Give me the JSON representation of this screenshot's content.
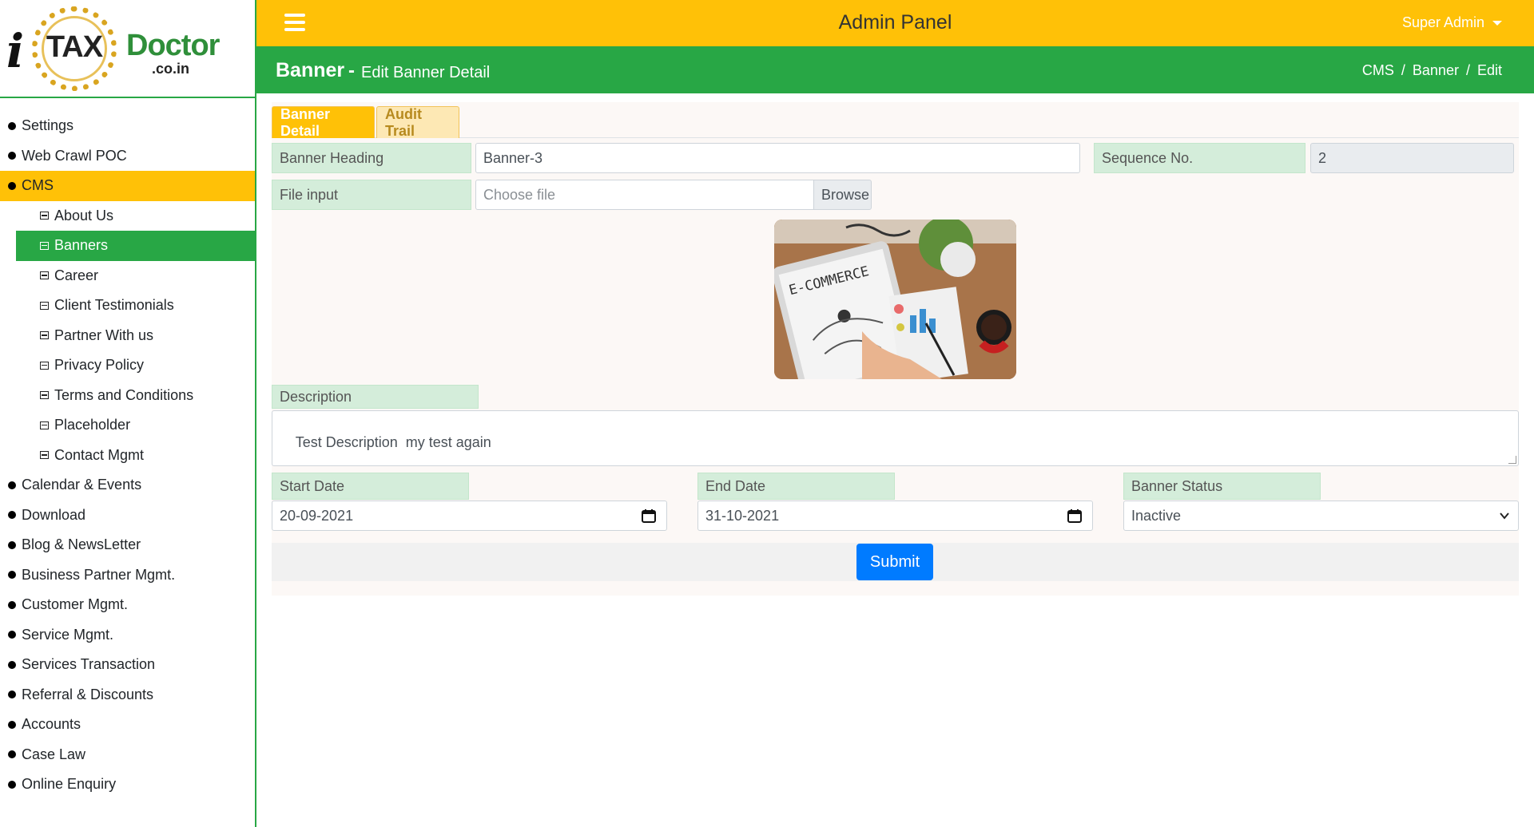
{
  "logo": {
    "letter_i": "i",
    "tax": "TAX",
    "doctor": "Doctor",
    "domain": ".co.in"
  },
  "sidebar": {
    "items": [
      {
        "label": "Settings"
      },
      {
        "label": "Web Crawl POC"
      },
      {
        "label": "CMS",
        "active": true,
        "children": [
          {
            "label": "About Us"
          },
          {
            "label": "Banners",
            "active": true
          },
          {
            "label": "Career"
          },
          {
            "label": "Client Testimonials"
          },
          {
            "label": "Partner With us"
          },
          {
            "label": "Privacy Policy"
          },
          {
            "label": "Terms and Conditions"
          },
          {
            "label": "Placeholder"
          },
          {
            "label": "Contact Mgmt"
          }
        ]
      },
      {
        "label": "Calendar & Events"
      },
      {
        "label": "Download"
      },
      {
        "label": "Blog & NewsLetter"
      },
      {
        "label": "Business Partner Mgmt."
      },
      {
        "label": "Customer Mgmt."
      },
      {
        "label": "Service Mgmt."
      },
      {
        "label": "Services Transaction"
      },
      {
        "label": "Referral & Discounts"
      },
      {
        "label": "Accounts"
      },
      {
        "label": "Case Law"
      },
      {
        "label": "Online Enquiry"
      }
    ]
  },
  "topbar": {
    "title": "Admin Panel",
    "user": "Super Admin",
    "menu_icon": "hamburger-icon"
  },
  "page": {
    "title": "Banner",
    "separator": "-",
    "subtitle": "Edit Banner Detail",
    "breadcrumb": [
      "CMS",
      "/",
      "Banner",
      "/",
      "Edit"
    ]
  },
  "tabs": [
    {
      "label": "Banner Detail",
      "active": true
    },
    {
      "label": "Audit Trail",
      "active": false
    }
  ],
  "form": {
    "banner_heading_label": "Banner Heading",
    "banner_heading_value": "Banner-3",
    "sequence_label": "Sequence No.",
    "sequence_value": "2",
    "file_label": "File input",
    "file_placeholder": "Choose file",
    "browse_label": "Browse",
    "image_text": "E-COMMERCE",
    "description_label": "Description",
    "description_value": "Test Description  my test again",
    "start_date_label": "Start Date",
    "start_date_value": "20-09-2021",
    "end_date_label": "End Date",
    "end_date_value": "31-10-2021",
    "status_label": "Banner Status",
    "status_value": "Inactive",
    "submit_label": "Submit"
  },
  "colors": {
    "topbar": "#ffc107",
    "header": "#28a745",
    "label_bg": "#d4edda",
    "submit": "#007bff"
  }
}
